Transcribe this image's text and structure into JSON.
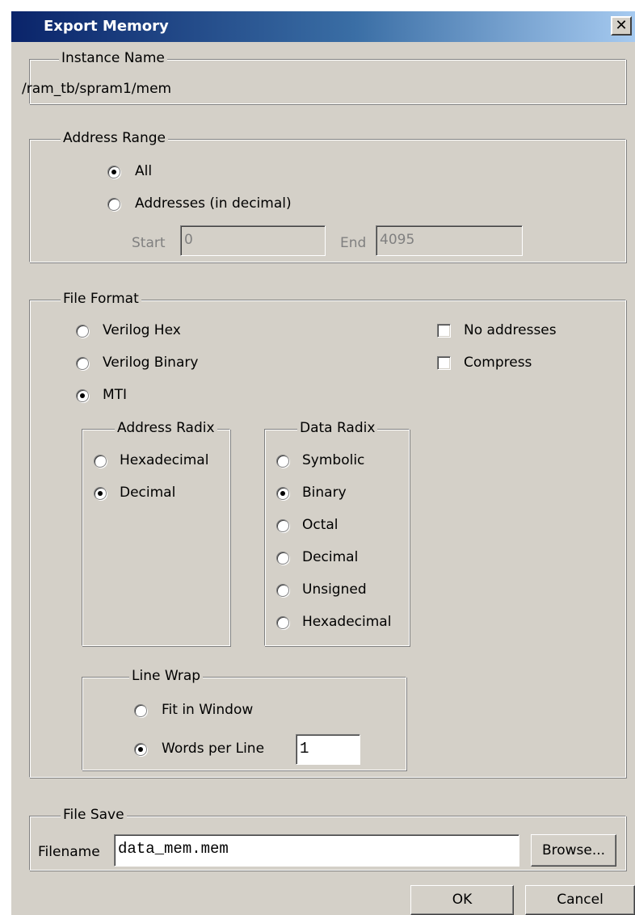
{
  "window": {
    "title": "Export Memory",
    "close_glyph": "✕"
  },
  "instance": {
    "legend": "Instance Name",
    "value": "/ram_tb/spram1/mem"
  },
  "address_range": {
    "legend": "Address Range",
    "all_label": "All",
    "addresses_label": "Addresses (in decimal)",
    "selected": "All",
    "start_label": "Start",
    "start_value": "0",
    "end_label": "End",
    "end_value": "4095"
  },
  "file_format": {
    "legend": "File Format",
    "formats": [
      "Verilog Hex",
      "Verilog Binary",
      "MTI"
    ],
    "selected_format": "MTI",
    "no_addresses_label": "No addresses",
    "no_addresses_checked": false,
    "compress_label": "Compress",
    "compress_checked": false,
    "address_radix": {
      "legend": "Address Radix",
      "options": [
        "Hexadecimal",
        "Decimal"
      ],
      "selected": "Decimal"
    },
    "data_radix": {
      "legend": "Data Radix",
      "options": [
        "Symbolic",
        "Binary",
        "Octal",
        "Decimal",
        "Unsigned",
        "Hexadecimal"
      ],
      "selected": "Binary"
    },
    "line_wrap": {
      "legend": "Line Wrap",
      "fit_label": "Fit in Window",
      "words_label": "Words per Line",
      "selected": "Words per Line",
      "words_value": "1"
    }
  },
  "file_save": {
    "legend": "File Save",
    "filename_label": "Filename",
    "filename_value": "data_mem.mem",
    "browse_label": "Browse..."
  },
  "buttons": {
    "ok": "OK",
    "cancel": "Cancel"
  }
}
